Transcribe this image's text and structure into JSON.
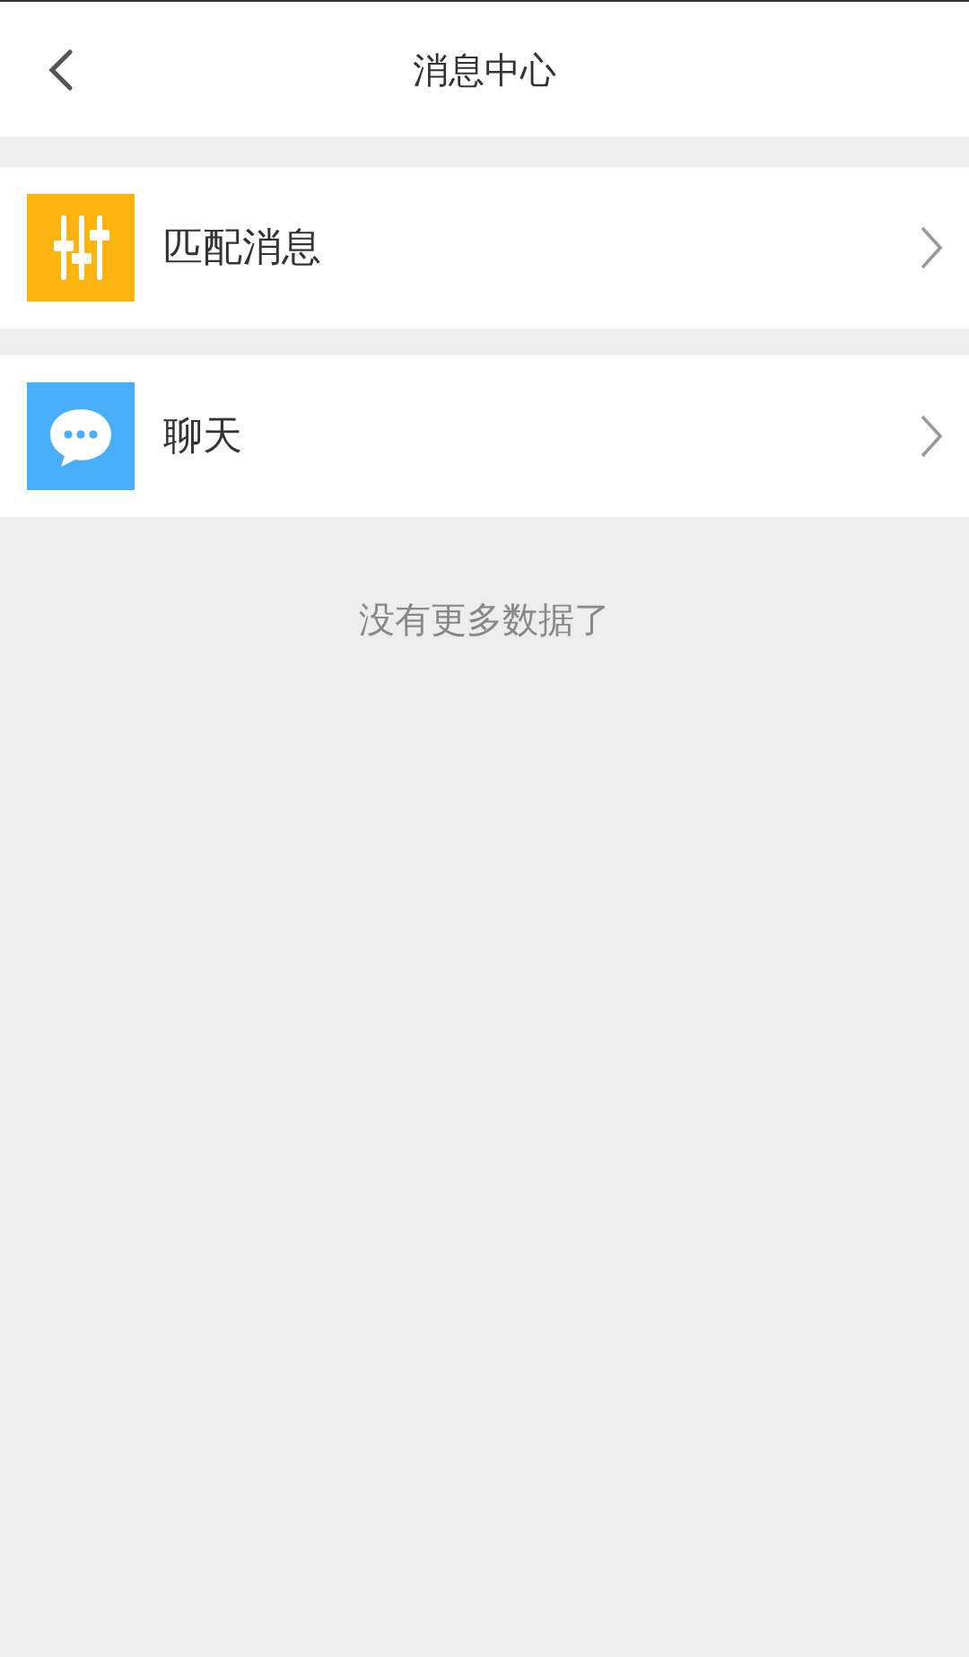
{
  "header": {
    "title": "消息中心"
  },
  "items": [
    {
      "label": "匹配消息",
      "kind": "sliders",
      "color": "#fdb40f"
    },
    {
      "label": "聊天",
      "kind": "chat",
      "color": "#49aefc"
    }
  ],
  "footer_note": "没有更多数据了"
}
